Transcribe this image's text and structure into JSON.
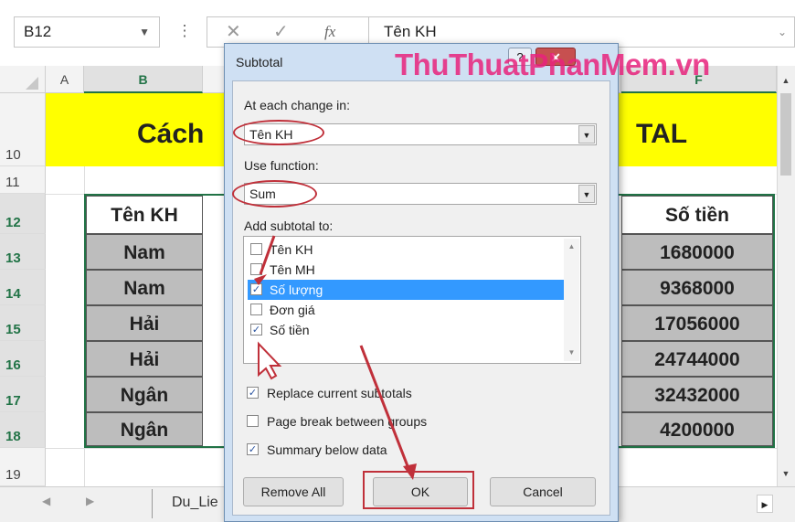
{
  "formula_bar": {
    "name_box": "B12",
    "formula_value": "Tên KH",
    "fx_label": "fx",
    "cancel_glyph": "✕",
    "enter_glyph": "✓",
    "menu_dots": "⋮"
  },
  "columns": [
    "A",
    "B",
    "F"
  ],
  "rows": [
    "10",
    "11",
    "12",
    "13",
    "14",
    "15",
    "16",
    "17",
    "18",
    "19"
  ],
  "sheet": {
    "title_left": "Cách",
    "title_right": "TAL",
    "table": {
      "header_name": "Tên KH",
      "header_amount": "Số tiền",
      "names": [
        "Nam",
        "Nam",
        "Hải",
        "Hải",
        "Ngân",
        "Ngân"
      ],
      "amounts": [
        "1680000",
        "9368000",
        "17056000",
        "24744000",
        "32432000",
        "4200000"
      ]
    },
    "tab_name": "Du_Lie"
  },
  "dialog": {
    "title": "Subtotal",
    "help_label": "?",
    "close_label": "✕",
    "watermark": "ThuThuatPhanMem.vn",
    "at_each_change_label": "At each change in:",
    "at_each_change_value": "Tên KH",
    "use_function_label": "Use function:",
    "use_function_value": "Sum",
    "add_subtotal_label": "Add subtotal to:",
    "fields": [
      {
        "label": "Tên KH",
        "checked": false
      },
      {
        "label": "Tên MH",
        "checked": false
      },
      {
        "label": "Số lượng",
        "checked": true,
        "selected": true
      },
      {
        "label": "Đơn giá",
        "checked": false
      },
      {
        "label": "Số tiền",
        "checked": true
      }
    ],
    "options": [
      {
        "label": "Replace current subtotals",
        "checked": true
      },
      {
        "label": "Page break between groups",
        "checked": false
      },
      {
        "label": "Summary below data",
        "checked": true
      }
    ],
    "buttons": {
      "remove_all": "Remove All",
      "ok": "OK",
      "cancel": "Cancel"
    }
  },
  "colors": {
    "accent_green": "#217346",
    "highlight_red": "#c0303a",
    "title_band": "#ffff00",
    "selection_blue": "#3399ff"
  }
}
